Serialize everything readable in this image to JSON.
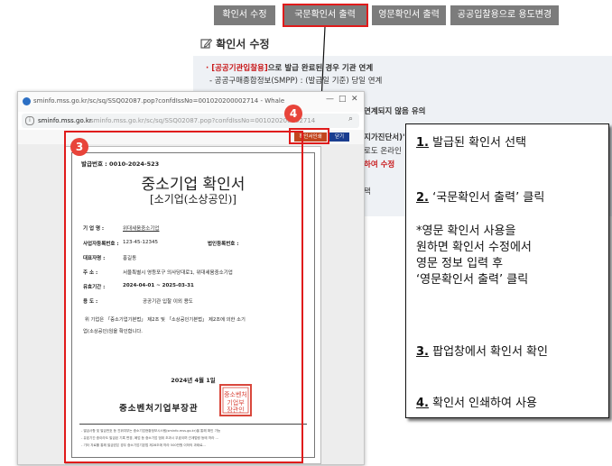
{
  "toolbar": {
    "items": [
      "확인서 수정",
      "국문확인서 출력",
      "영문확인서 출력",
      "공공입찰용으로 용도변경"
    ]
  },
  "background": {
    "section_title": "확인서 수정",
    "line1_highlight": "[공공기관입찰용]",
    "line1_rest": "으로 발급 완료된 경우 기관 연계",
    "line2": "- 공공구매종합정보(SMPP) : (발급일 기준) 당일 연계",
    "frag1": "연계되지 않음 유의",
    "frag2": "지가진단서)'",
    "frag3": "로도 온라인",
    "frag4": "하여 수정",
    "frag5": "택"
  },
  "popup": {
    "tab_title": "sminfo.mss.go.kr/sc/sq/SSQ02087.pop?confdIssNo=001020200002714 - Whale",
    "address_host": "sminfo.mss.go.kr",
    "address_rest": " sminfo.mss.go.kr/sc/sq/SSQ02087.pop?confdIssNo=001020200002714",
    "print_button": "확인서인쇄",
    "close_button": "닫기",
    "badge3": "3",
    "badge4": "4"
  },
  "certificate": {
    "issue_label": "발급번호 : 0010-2024-523",
    "title": "중소기업  확인서",
    "subtitle": "[소기업(소상공인)]",
    "rows": [
      {
        "label": "기  업  명 :",
        "value": "위대세움중소기업"
      },
      {
        "label": "사업자등록번호 :",
        "value": "123-45-12345",
        "extra": "법인등록번호 :"
      },
      {
        "label": "대표자명 :",
        "value": "홍길동"
      },
      {
        "label": "주      소 :",
        "value": "서울특별시 영등포구 의사당대로1, 위대세움중소기업"
      },
      {
        "label": "유효기간 :",
        "value": "2024-04-01 ~ 2025-03-31"
      },
      {
        "label": "용      도 :",
        "value": "공공기관 입찰 이외 용도"
      }
    ],
    "statement_line1": "위 기업은 「중소기업기본법」 제2조 및 「소상공인기본법」 제2조에 의한 소기",
    "statement_line2": "업(소상공인)임을 확인합니다.",
    "date": "2024년  4월  1일",
    "authority": "중소벤처기업부장관",
    "seal_text": "중소벤처 기업부 장관인",
    "notes": [
      "- 발급사항 및 발급번호 등 진위여부는 중소기업현황정보시스템(sminfo.mss.go.kr)을 통해 확인 가능",
      "- 유효기간 중이라도 발급된 기록 변경, 폐업 등 중소기업 범위 초과시 무효이며 관계법령 등에 따라 ...",
      "- 기타 자료를 통해 발급받은 경우 중소기업기본법 제28조에 따라 500만원 이하의 과태료..."
    ]
  },
  "instructions": [
    {
      "num": "1.",
      "text": " 발급된 확인서 선택"
    },
    {
      "num": "2.",
      "text": " ‘국문확인서 출력’ 클릭"
    },
    {
      "text": "*영문 확인서 사용을"
    },
    {
      "text": "원하면 확인서 수정에서"
    },
    {
      "text": "영문 정보 입력 후"
    },
    {
      "text": "‘영문확인서 출력’ 클릭"
    },
    {
      "num": "3.",
      "text": " 팝업창에서 확인서 확인"
    },
    {
      "num": "4.",
      "text": " 확인서 인쇄하여 사용"
    }
  ],
  "colors": {
    "highlight_red": "#e01b1b",
    "toolbar_gray": "#7c7c7c",
    "badge_red": "#e8443a",
    "seal_red": "#d9473c"
  }
}
